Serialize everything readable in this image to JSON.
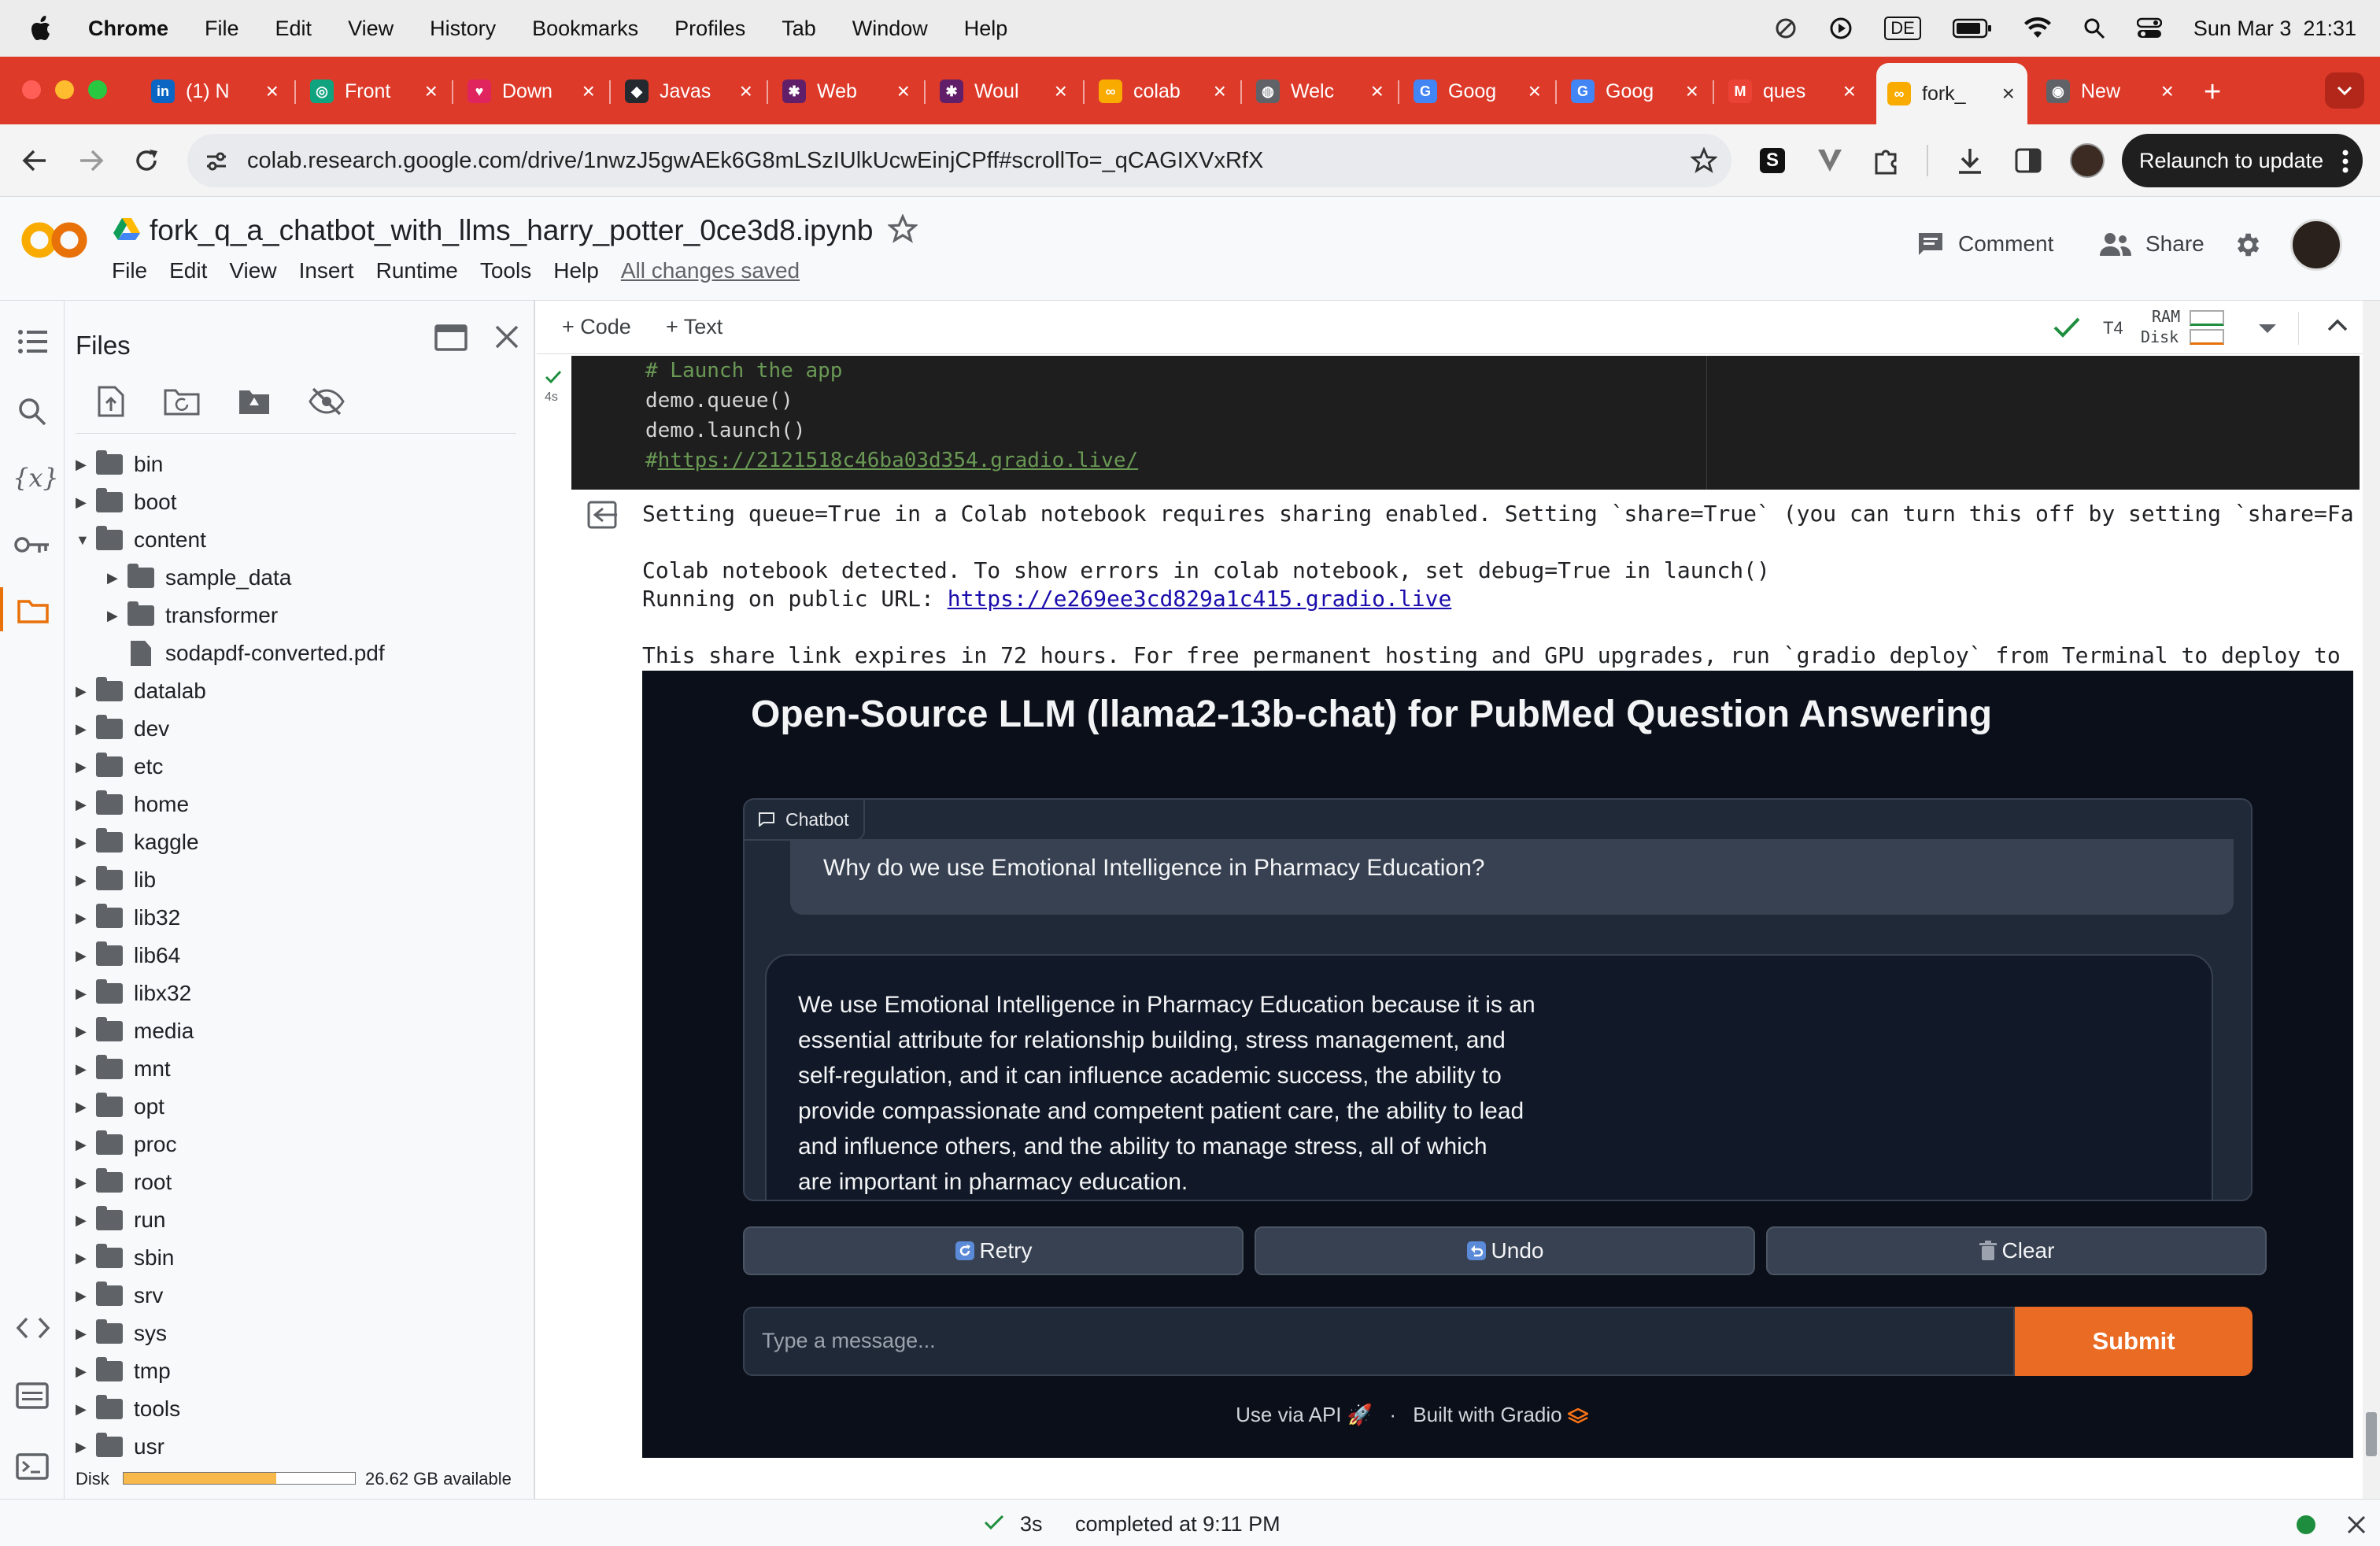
{
  "menubar": {
    "app_name": "Chrome",
    "items": [
      "File",
      "Edit",
      "View",
      "History",
      "Bookmarks",
      "Profiles",
      "Tab",
      "Window",
      "Help"
    ],
    "input_source": "DE",
    "datetime": "Sun Mar 3  21:31"
  },
  "tabs": [
    {
      "label": "(1) N",
      "icon": "linkedin-icon",
      "color": "#0a66c2"
    },
    {
      "label": "Front",
      "icon": "openai-icon",
      "color": "#10a37f"
    },
    {
      "label": "Down",
      "icon": "heart-icon",
      "color": "#e0245e"
    },
    {
      "label": "Javas",
      "icon": "github-icon",
      "color": "#24292f"
    },
    {
      "label": "Web",
      "icon": "slack-icon",
      "color": "#611f69"
    },
    {
      "label": "Woul",
      "icon": "slack-icon",
      "color": "#611f69"
    },
    {
      "label": "colab",
      "icon": "colab-icon",
      "color": "#f9ab00"
    },
    {
      "label": "Welc",
      "icon": "globe-icon",
      "color": "#5f6368"
    },
    {
      "label": "Goog",
      "icon": "google-icon",
      "color": "#4285f4"
    },
    {
      "label": "Goog",
      "icon": "google-icon",
      "color": "#4285f4"
    },
    {
      "label": "ques",
      "icon": "gmail-icon",
      "color": "#ea4335"
    },
    {
      "label": "fork_",
      "icon": "colab-icon",
      "color": "#f9ab00",
      "active": true
    },
    {
      "label": "New",
      "icon": "chrome-icon",
      "color": "#5f6368"
    }
  ],
  "toolbar": {
    "url": "colab.research.google.com/drive/1nwzJ5gwAEk6G8mLSzIUlkUcwEinjCPff#scrollTo=_qCAGIXVxRfX",
    "relaunch_label": "Relaunch to update"
  },
  "colab": {
    "notebook_title": "fork_q_a_chatbot_with_llms_harry_potter_0ce3d8.ipynb",
    "menu": [
      "File",
      "Edit",
      "View",
      "Insert",
      "Runtime",
      "Tools",
      "Help"
    ],
    "saved_status": "All changes saved",
    "comment_label": "Comment",
    "share_label": "Share",
    "add_code_label": "+ Code",
    "add_text_label": "+ Text",
    "runtime_type": "T4",
    "ram_label": "RAM",
    "disk_label": "Disk"
  },
  "files_panel": {
    "title": "Files",
    "tree": [
      {
        "name": "bin",
        "type": "folder",
        "depth": 0,
        "expanded": false
      },
      {
        "name": "boot",
        "type": "folder",
        "depth": 0,
        "expanded": false
      },
      {
        "name": "content",
        "type": "folder",
        "depth": 0,
        "expanded": true
      },
      {
        "name": "sample_data",
        "type": "folder",
        "depth": 1,
        "expanded": false
      },
      {
        "name": "transformer",
        "type": "folder",
        "depth": 1,
        "expanded": false
      },
      {
        "name": "sodapdf-converted.pdf",
        "type": "file",
        "depth": 1
      },
      {
        "name": "datalab",
        "type": "folder",
        "depth": 0,
        "expanded": false
      },
      {
        "name": "dev",
        "type": "folder",
        "depth": 0,
        "expanded": false
      },
      {
        "name": "etc",
        "type": "folder",
        "depth": 0,
        "expanded": false
      },
      {
        "name": "home",
        "type": "folder",
        "depth": 0,
        "expanded": false
      },
      {
        "name": "kaggle",
        "type": "folder",
        "depth": 0,
        "expanded": false
      },
      {
        "name": "lib",
        "type": "folder",
        "depth": 0,
        "expanded": false
      },
      {
        "name": "lib32",
        "type": "folder",
        "depth": 0,
        "expanded": false
      },
      {
        "name": "lib64",
        "type": "folder",
        "depth": 0,
        "expanded": false
      },
      {
        "name": "libx32",
        "type": "folder",
        "depth": 0,
        "expanded": false
      },
      {
        "name": "media",
        "type": "folder",
        "depth": 0,
        "expanded": false
      },
      {
        "name": "mnt",
        "type": "folder",
        "depth": 0,
        "expanded": false
      },
      {
        "name": "opt",
        "type": "folder",
        "depth": 0,
        "expanded": false
      },
      {
        "name": "proc",
        "type": "folder",
        "depth": 0,
        "expanded": false
      },
      {
        "name": "root",
        "type": "folder",
        "depth": 0,
        "expanded": false
      },
      {
        "name": "run",
        "type": "folder",
        "depth": 0,
        "expanded": false
      },
      {
        "name": "sbin",
        "type": "folder",
        "depth": 0,
        "expanded": false
      },
      {
        "name": "srv",
        "type": "folder",
        "depth": 0,
        "expanded": false
      },
      {
        "name": "sys",
        "type": "folder",
        "depth": 0,
        "expanded": false
      },
      {
        "name": "tmp",
        "type": "folder",
        "depth": 0,
        "expanded": false
      },
      {
        "name": "tools",
        "type": "folder",
        "depth": 0,
        "expanded": false
      },
      {
        "name": "usr",
        "type": "folder",
        "depth": 0,
        "expanded": false
      }
    ],
    "disk_label": "Disk",
    "disk_available": "26.62 GB available",
    "disk_used_fraction": 0.66
  },
  "cell": {
    "exec_time": "4s",
    "code_comment": "# Launch the app",
    "code_line_1": "demo.queue()",
    "code_line_2": "demo.launch()",
    "code_line_3_hash": "#",
    "code_line_3_link": "https://2121518c46ba03d354.gradio.live/",
    "output_line_1": "Setting queue=True in a Colab notebook requires sharing enabled. Setting `share=True` (you can turn this off by setting `share=Fa",
    "output_line_2": "Colab notebook detected. To show errors in colab notebook, set debug=True in launch()",
    "output_line_3_prefix": "Running on public URL: ",
    "output_line_3_link": "https://e269ee3cd829a1c415.gradio.live",
    "output_line_4": "This share link expires in 72 hours. For free permanent hosting and GPU upgrades, run `gradio deploy` from Terminal to deploy to"
  },
  "gradio": {
    "title": "Open-Source LLM (llama2-13b-chat) for PubMed Question Answering",
    "chatbot_label": "Chatbot",
    "user_message": "Why do we use Emotional Intelligence in Pharmacy Education?",
    "bot_message_lines": [
      "We use Emotional Intelligence in Pharmacy Education because it is an",
      "essential attribute for relationship building, stress management, and",
      "self-regulation, and it can influence academic success, the ability to",
      "provide compassionate and competent patient care, the ability to lead",
      "and influence others, and the ability to manage stress, all of which",
      "are important in pharmacy education."
    ],
    "retry_label": "Retry",
    "undo_label": "Undo",
    "clear_label": "Clear",
    "input_placeholder": "Type a message...",
    "submit_label": "Submit",
    "footer_api": "Use via API",
    "footer_sep": "·",
    "footer_built": "Built with Gradio"
  },
  "statusbar": {
    "duration": "3s",
    "completed_text": "completed at 9:11 PM"
  }
}
